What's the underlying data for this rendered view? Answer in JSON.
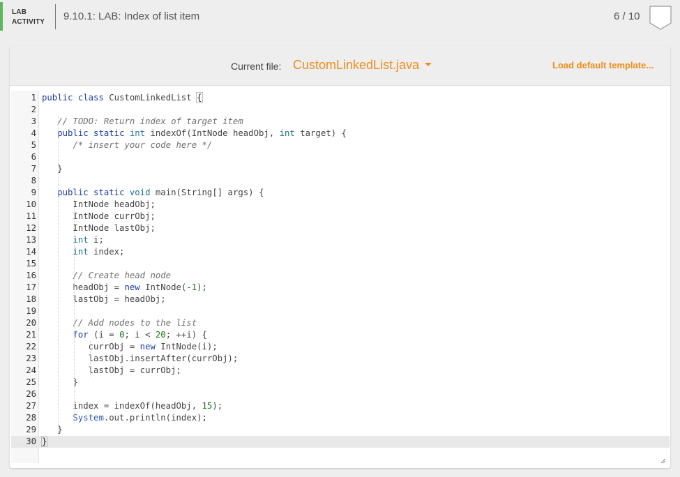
{
  "header": {
    "lab_line1": "LAB",
    "lab_line2": "ACTIVITY",
    "title": "9.10.1: LAB: Index of list item",
    "score": "6 / 10",
    "accent_color": "#5cb85c"
  },
  "toolbar": {
    "current_file_label": "Current file:",
    "file_name": "CustomLinkedList.java",
    "load_default_label": "Load default template...",
    "accent_color": "#f18d1a"
  },
  "editor": {
    "active_line": 30,
    "lines": [
      {
        "n": "1",
        "code": [
          [
            "kw",
            "public"
          ],
          [
            "op",
            " "
          ],
          [
            "kw",
            "class"
          ],
          [
            "op",
            " CustomLinkedList "
          ],
          [
            "br",
            "{"
          ]
        ]
      },
      {
        "n": "2",
        "code": []
      },
      {
        "n": "3",
        "code": [
          [
            "op",
            "   "
          ],
          [
            "cm",
            "// TODO: Return index of target item"
          ]
        ]
      },
      {
        "n": "4",
        "code": [
          [
            "op",
            "   "
          ],
          [
            "kw",
            "public"
          ],
          [
            "op",
            " "
          ],
          [
            "kw",
            "static"
          ],
          [
            "op",
            " "
          ],
          [
            "tp",
            "int"
          ],
          [
            "op",
            " indexOf(IntNode headObj, "
          ],
          [
            "tp",
            "int"
          ],
          [
            "op",
            " target) {"
          ]
        ]
      },
      {
        "n": "5",
        "code": [
          [
            "op",
            "      "
          ],
          [
            "cm",
            "/* insert your code here */"
          ]
        ]
      },
      {
        "n": "6",
        "code": []
      },
      {
        "n": "7",
        "code": [
          [
            "op",
            "   }"
          ]
        ]
      },
      {
        "n": "8",
        "code": []
      },
      {
        "n": "9",
        "code": [
          [
            "op",
            "   "
          ],
          [
            "kw",
            "public"
          ],
          [
            "op",
            " "
          ],
          [
            "kw",
            "static"
          ],
          [
            "op",
            " "
          ],
          [
            "tp",
            "void"
          ],
          [
            "op",
            " main(String[] args) {"
          ]
        ]
      },
      {
        "n": "10",
        "code": [
          [
            "op",
            "      IntNode headObj;"
          ]
        ]
      },
      {
        "n": "11",
        "code": [
          [
            "op",
            "      IntNode currObj;"
          ]
        ]
      },
      {
        "n": "12",
        "code": [
          [
            "op",
            "      IntNode lastObj;"
          ]
        ]
      },
      {
        "n": "13",
        "code": [
          [
            "op",
            "      "
          ],
          [
            "tp",
            "int"
          ],
          [
            "op",
            " i;"
          ]
        ]
      },
      {
        "n": "14",
        "code": [
          [
            "op",
            "      "
          ],
          [
            "tp",
            "int"
          ],
          [
            "op",
            " index;"
          ]
        ]
      },
      {
        "n": "15",
        "code": []
      },
      {
        "n": "16",
        "code": [
          [
            "op",
            "      "
          ],
          [
            "cm",
            "// Create head node"
          ]
        ]
      },
      {
        "n": "17",
        "code": [
          [
            "op",
            "      headObj = "
          ],
          [
            "kw",
            "new"
          ],
          [
            "op",
            " IntNode("
          ],
          [
            "nm",
            "-1"
          ],
          [
            "op",
            ");"
          ]
        ]
      },
      {
        "n": "18",
        "code": [
          [
            "op",
            "      lastObj = headObj;"
          ]
        ]
      },
      {
        "n": "19",
        "code": []
      },
      {
        "n": "20",
        "code": [
          [
            "op",
            "      "
          ],
          [
            "cm",
            "// Add nodes to the list"
          ]
        ]
      },
      {
        "n": "21",
        "code": [
          [
            "op",
            "      "
          ],
          [
            "kw",
            "for"
          ],
          [
            "op",
            " (i = "
          ],
          [
            "nm",
            "0"
          ],
          [
            "op",
            "; i < "
          ],
          [
            "nm",
            "20"
          ],
          [
            "op",
            "; ++i) {"
          ]
        ]
      },
      {
        "n": "22",
        "code": [
          [
            "op",
            "         currObj = "
          ],
          [
            "kw",
            "new"
          ],
          [
            "op",
            " IntNode(i);"
          ]
        ]
      },
      {
        "n": "23",
        "code": [
          [
            "op",
            "         lastObj.insertAfter(currObj);"
          ]
        ]
      },
      {
        "n": "24",
        "code": [
          [
            "op",
            "         lastObj = currObj;"
          ]
        ]
      },
      {
        "n": "25",
        "code": [
          [
            "op",
            "      }"
          ]
        ]
      },
      {
        "n": "26",
        "code": []
      },
      {
        "n": "27",
        "code": [
          [
            "op",
            "      index = indexOf(headObj, "
          ],
          [
            "nm",
            "15"
          ],
          [
            "op",
            ");"
          ]
        ]
      },
      {
        "n": "28",
        "code": [
          [
            "op",
            "      "
          ],
          [
            "sys",
            "System"
          ],
          [
            "op",
            ".out.println(index);"
          ]
        ]
      },
      {
        "n": "29",
        "code": [
          [
            "op",
            "   }"
          ]
        ]
      },
      {
        "n": "30",
        "code": [
          [
            "br",
            "}"
          ]
        ]
      }
    ]
  }
}
